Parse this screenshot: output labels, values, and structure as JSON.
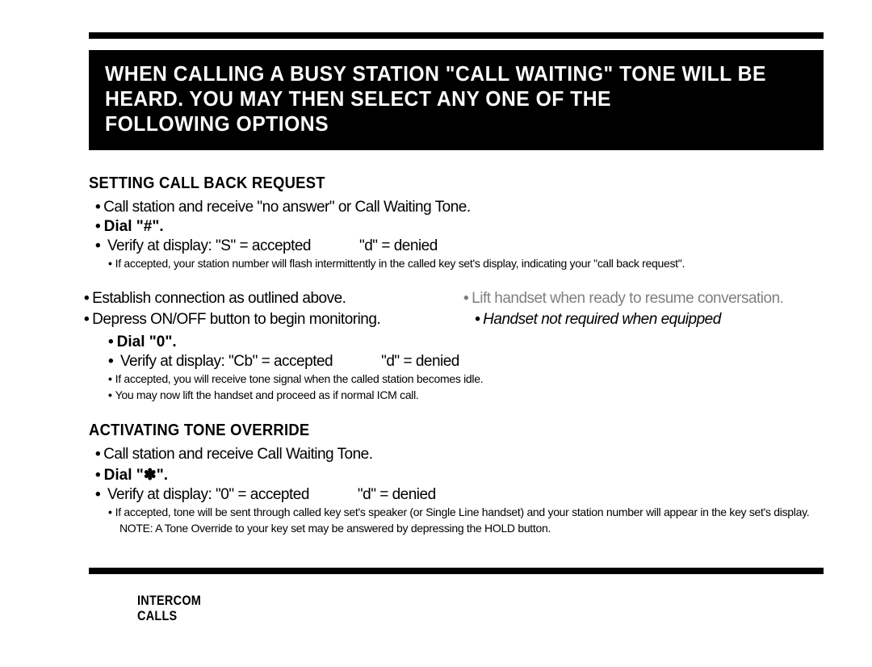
{
  "hero": {
    "line1": "WHEN CALLING A BUSY STATION \"CALL WAITING\" TONE WILL BE",
    "line2": "HEARD. YOU MAY THEN SELECT ANY ONE OF THE",
    "line3": "FOLLOWING OPTIONS"
  },
  "section1": {
    "heading": "SETTING CALL BACK REQUEST",
    "step1": "Call station and receive \"no answer\" or Call Waiting Tone.",
    "dial": "Dial \"#\".",
    "verify_a": "Verify at display: \"S\" = accepted",
    "verify_b": "\"d\" = denied",
    "note1": "If accepted, your station number will flash intermittently in the called key set's display, indicating your \"call back request\"."
  },
  "middle": {
    "left_frag1": "Establish connection as outlined above.",
    "left_frag2": "Depress ON/OFF button to begin monitoring.",
    "right_frag1": "Lift handset when ready to resume conversation.",
    "right_ital": "Handset not required when equipped",
    "dial": "Dial \"0\".",
    "verify_a": "Verify at display: \"Cb\" = accepted",
    "verify_b": "\"d\" = denied",
    "note1": "If accepted, you will receive tone signal when the called station becomes idle.",
    "note2": "You may now lift the handset and proceed as if normal ICM call."
  },
  "section2": {
    "heading": "ACTIVATING TONE OVERRIDE",
    "step1": "Call station and receive Call Waiting Tone.",
    "dial": "Dial \"✽\".",
    "verify_a": "Verify at display: \"0\" = accepted",
    "verify_b": "\"d\" = denied",
    "note1": "If accepted, tone will be sent through called key set's speaker (or Single Line handset) and your station number will appear in the key set's display.",
    "note2": "NOTE: A Tone Override to your key set may be answered by depressing the HOLD button."
  },
  "footer": {
    "line1": "INTERCOM",
    "line2": "CALLS"
  }
}
